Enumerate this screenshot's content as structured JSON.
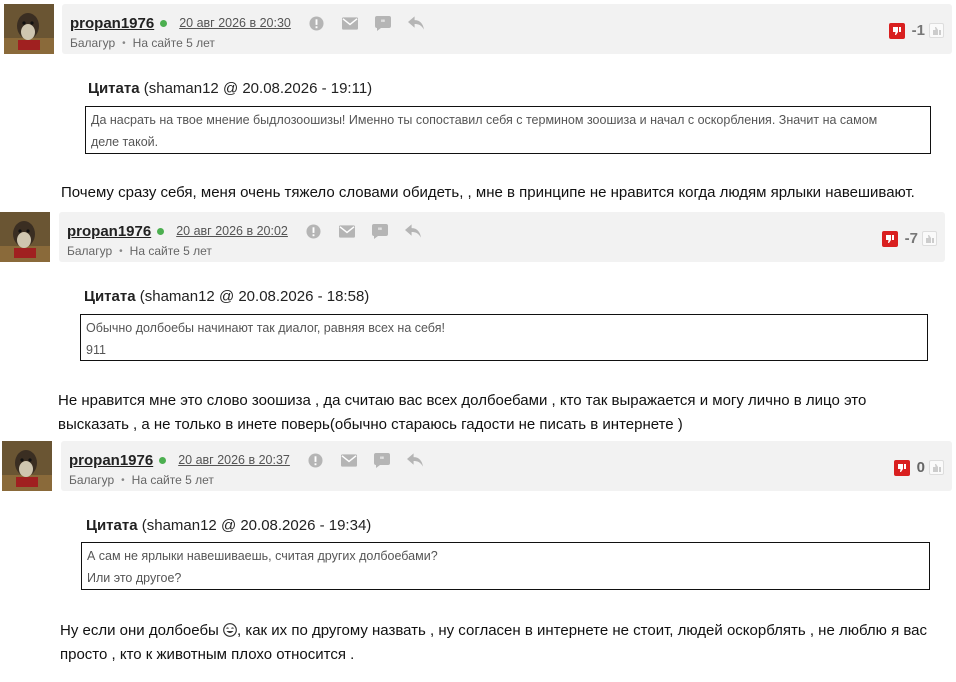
{
  "comments": [
    {
      "author": "propan1976",
      "date": "20 авг 2026 в 20:30",
      "rank": "Балагур",
      "on_site": "На сайте 5 лет",
      "score": "-1",
      "quote_label": "Цитата",
      "quote_source": "(shaman12 @ 20.08.2026 - 19:11)",
      "quote_lines": [
        "Да насрать на твое мнение быдлозоошизы! Именно ты сопоставил себя с термином зоошиза и начал с оскорбления. Значит на самом",
        "деле такой."
      ],
      "text_lines": [
        "Почему сразу себя, меня очень тяжело словами обидеть, , мне в принципе не нравится когда людям ярлыки навешивают."
      ]
    },
    {
      "author": "propan1976",
      "date": "20 авг 2026 в 20:02",
      "rank": "Балагур",
      "on_site": "На сайте 5 лет",
      "score": "-7",
      "quote_label": "Цитата",
      "quote_source": "(shaman12 @ 20.08.2026 - 18:58)",
      "quote_lines": [
        "Обычно долбоебы начинают так диалог, равняя всех на себя!",
        "911"
      ],
      "text_lines": [
        "Не нравится мне это слово зоошиза , да считаю вас всех долбоебами , кто так выражается и могу лично в лицо это",
        "высказать , а не только в инете поверь(обычно стараюсь гадости не писать в интернете )"
      ]
    },
    {
      "author": "propan1976",
      "date": "20 авг 2026 в 20:37",
      "rank": "Балагур",
      "on_site": "На сайте 5 лет",
      "score": "0",
      "quote_label": "Цитата",
      "quote_source": "(shaman12 @ 20.08.2026 - 19:34)",
      "quote_lines": [
        "А сам не ярлыки навешиваешь, считая других долбоебами?",
        "Или это другое?"
      ],
      "text_before_smile": "Ну если они долбоебы ",
      "text_after_smile": ", как их по другому назвать , ну согласен в интернете не стоит, людей оскорблять , не люблю я вас",
      "text_line2": "просто , кто к животным плохо относится ."
    }
  ],
  "icons": [
    "complain-icon",
    "message-icon",
    "quote-icon",
    "reply-icon",
    "thumb-down-icon",
    "thumb-up-icon",
    "smile-icon",
    "online-dot"
  ],
  "colors": {
    "header_bg": "#f2f2f2",
    "downvote": "#d92020",
    "online": "#4caf50"
  }
}
